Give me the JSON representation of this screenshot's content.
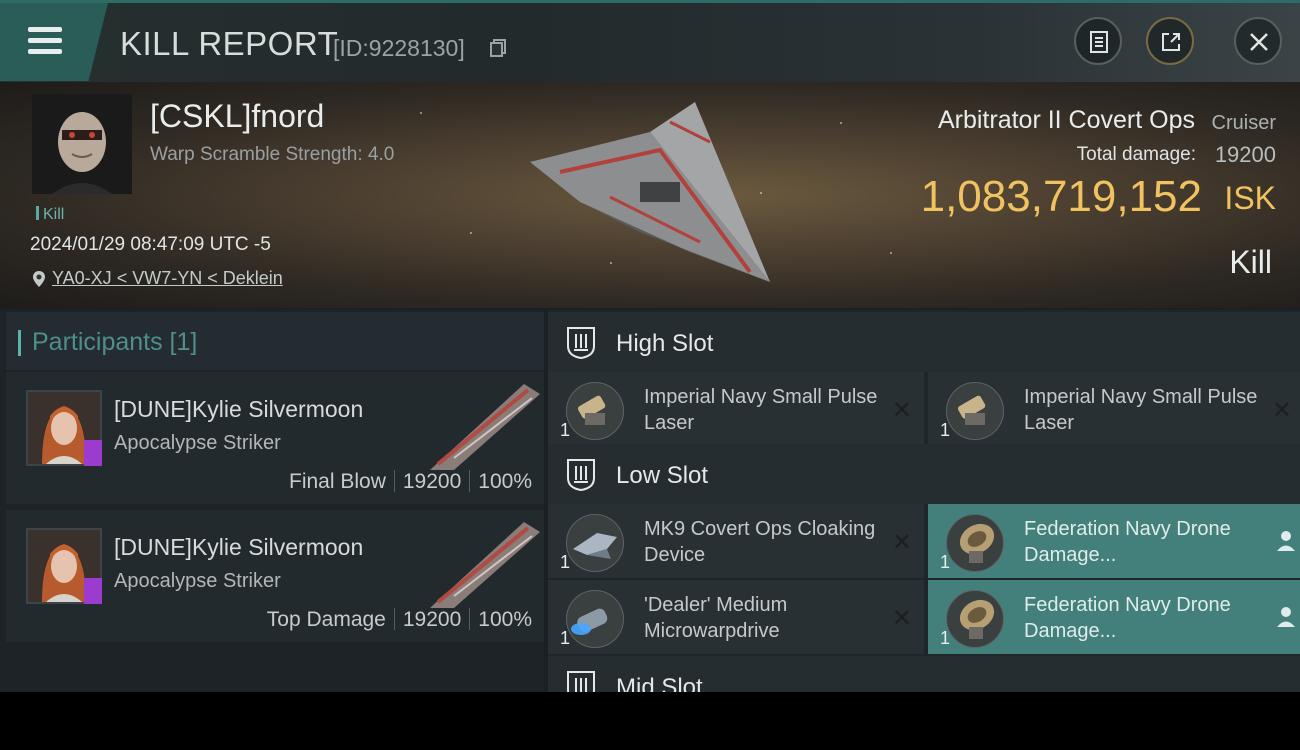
{
  "header": {
    "title": "KILL REPORT",
    "report_id": "[ID:9228130]"
  },
  "victim": {
    "name": "[CSKL]fnord",
    "warp_scramble": "Warp Scramble Strength: 4.0",
    "tag": "Kill",
    "datetime": "2024/01/29 08:47:09 UTC -5",
    "location": "YA0-XJ < VW7-YN < Deklein",
    "ship_name": "Arbitrator II Covert Ops",
    "ship_class": "Cruiser",
    "total_damage_label": "Total damage:",
    "total_damage_value": "19200",
    "isk_value": "1,083,719,152",
    "isk_unit": "ISK",
    "result_label": "Kill"
  },
  "participants": {
    "title": "Participants [1]",
    "items": [
      {
        "name": "[DUNE]Kylie Silvermoon",
        "ship": "Apocalypse Striker",
        "role": "Final Blow",
        "damage": "19200",
        "percent": "100%"
      },
      {
        "name": "[DUNE]Kylie Silvermoon",
        "ship": "Apocalypse Striker",
        "role": "Top Damage",
        "damage": "19200",
        "percent": "100%"
      }
    ]
  },
  "fitting": {
    "high_slot": {
      "title": "High Slot",
      "modules": [
        {
          "qty": "1",
          "name": "Imperial Navy Small Pulse Laser",
          "icon": "laser-icon",
          "status": "destroyed"
        },
        {
          "qty": "1",
          "name": "Imperial Navy Small Pulse Laser",
          "icon": "laser-icon",
          "status": "destroyed"
        }
      ]
    },
    "low_slot": {
      "title": "Low Slot",
      "modules": [
        {
          "qty": "1",
          "name": "MK9 Covert Ops Cloaking Device",
          "icon": "cloak-icon",
          "status": "destroyed"
        },
        {
          "qty": "1",
          "name": "Federation Navy Drone Damage...",
          "icon": "drone-damage-icon",
          "status": "dropped"
        },
        {
          "qty": "1",
          "name": "'Dealer' Medium Microwarpdrive",
          "icon": "microwarpdrive-icon",
          "status": "destroyed"
        },
        {
          "qty": "1",
          "name": "Federation Navy Drone Damage...",
          "icon": "drone-damage-icon",
          "status": "dropped"
        }
      ]
    },
    "mid_slot": {
      "title": "Mid Slot"
    }
  },
  "colors": {
    "accent": "#2e6d67",
    "isk": "#f0c260",
    "dropped_bg": "#44807b"
  }
}
